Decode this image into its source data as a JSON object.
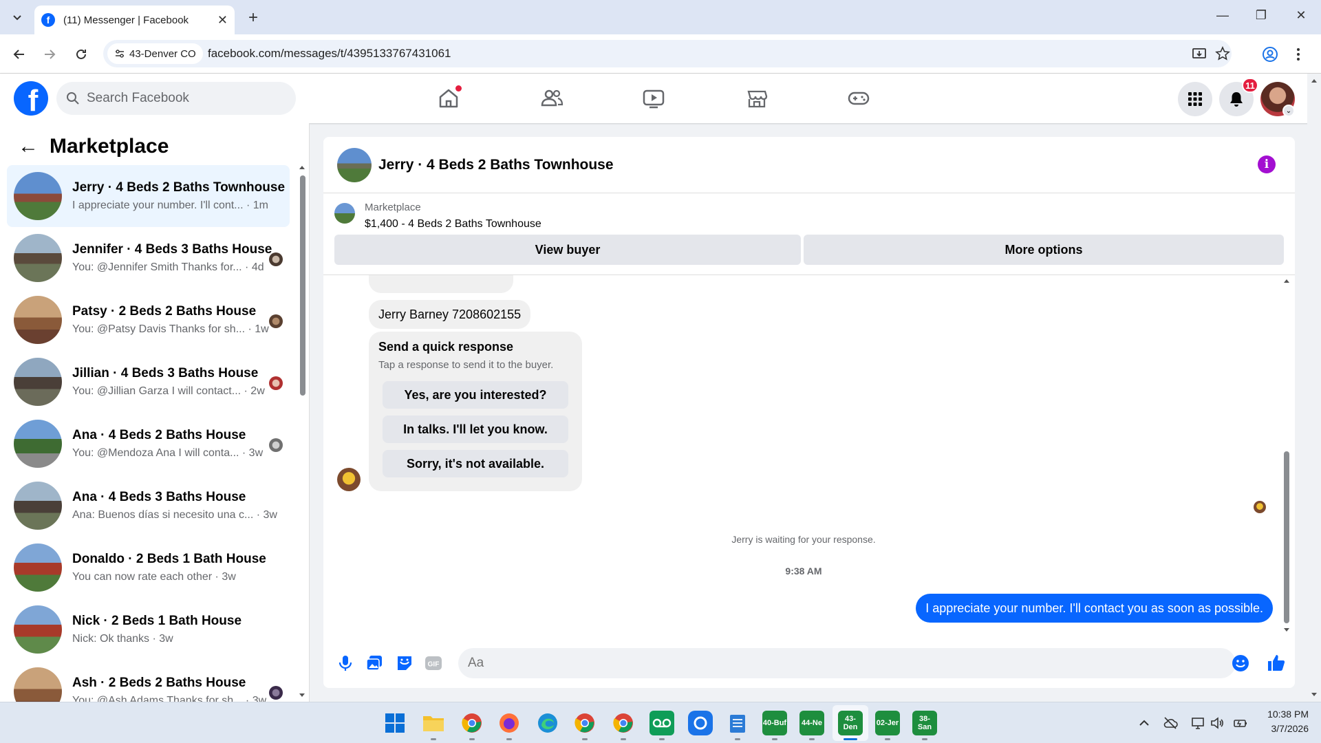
{
  "browser": {
    "tab_title": "(11) Messenger | Facebook",
    "site_chip": "43-Denver CO",
    "url": "facebook.com/messages/t/4395133767431061"
  },
  "fb": {
    "search_placeholder": "Search Facebook",
    "notification_count": "11",
    "brand_color": "#0866ff"
  },
  "left": {
    "title": "Marketplace",
    "conversations": [
      {
        "name": "Jerry · 4 Beds 2 Baths Townhouse",
        "preview": "I appreciate your number. I'll cont... · 1m",
        "active": true
      },
      {
        "name": "Jennifer · 4 Beds 3 Baths House",
        "preview": "You: @Jennifer Smith Thanks for... · 4d"
      },
      {
        "name": "Patsy · 2 Beds 2 Baths House",
        "preview": "You: @Patsy Davis Thanks for sh... · 1w"
      },
      {
        "name": "Jillian · 4 Beds 3 Baths House",
        "preview": "You: @Jillian Garza I will contact... · 2w"
      },
      {
        "name": "Ana · 4 Beds 2 Baths House",
        "preview": "You: @Mendoza Ana I will conta... · 3w"
      },
      {
        "name": "Ana · 4 Beds 3 Baths House",
        "preview": "Ana: Buenos días si necesito una c... · 3w"
      },
      {
        "name": "Donaldo · 2 Beds 1 Bath House",
        "preview": "You can now rate each other · 3w"
      },
      {
        "name": "Nick · 2 Beds 1 Bath House",
        "preview": "Nick: Ok thanks · 3w"
      },
      {
        "name": "Ash · 2 Beds 2 Baths House",
        "preview": "You: @Ash Adams Thanks for sh... · 3w"
      }
    ]
  },
  "chat": {
    "title": "Jerry · 4 Beds 2 Baths Townhouse",
    "marketplace_label": "Marketplace",
    "listing": "$1,400 - 4 Beds 2 Baths Townhouse",
    "view_buyer": "View buyer",
    "more_options": "More options",
    "phone_message": "Jerry Barney 7208602155",
    "quick_response": {
      "title": "Send a quick response",
      "subtitle": "Tap a response to send it to the buyer.",
      "options": [
        "Yes, are you interested?",
        "In talks. I'll let you know.",
        "Sorry, it's not available."
      ]
    },
    "waiting": "Jerry is waiting for your response.",
    "time": "9:38 AM",
    "my_message": "I appreciate your number. I'll contact you as soon as possible.",
    "input_placeholder": "Aa"
  },
  "taskbar": {
    "apps": [
      {
        "label": "40-Buf"
      },
      {
        "label": "44-Ne"
      },
      {
        "label": "43-Den"
      },
      {
        "label": "02-Jer"
      },
      {
        "label": "38-San"
      }
    ],
    "time": "10:38 PM",
    "date": "3/7/2026"
  }
}
